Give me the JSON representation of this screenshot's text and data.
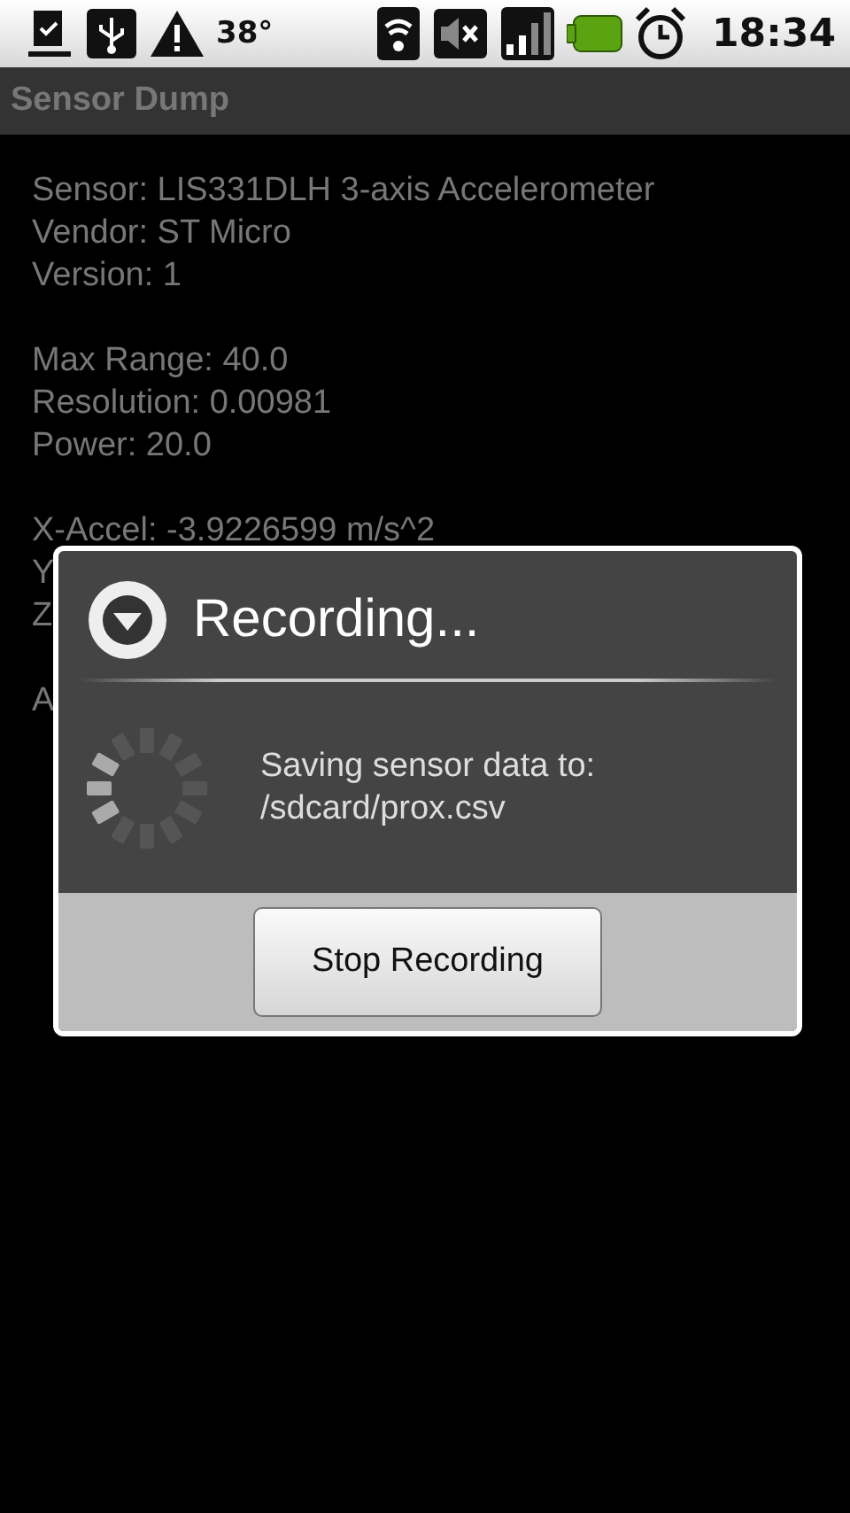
{
  "status_bar": {
    "temperature": "38°",
    "time": "18:34"
  },
  "title_bar": {
    "title": "Sensor Dump"
  },
  "sensor_info": [
    {
      "lines": [
        "Sensor: LIS331DLH 3-axis Accelerometer",
        "Vendor: ST Micro",
        "Version: 1"
      ]
    },
    {
      "lines": [
        "Max Range: 40.0",
        "Resolution: 0.00981",
        "Power: 20.0"
      ]
    },
    {
      "lines": [
        "X-Accel: -3.9226599 m/s^2",
        "Y",
        "Z"
      ]
    },
    {
      "lines": [
        "A"
      ]
    }
  ],
  "dialog": {
    "title": "Recording...",
    "message_lines": [
      "Saving sensor data to:",
      "/sdcard/prox.csv"
    ],
    "button": "Stop Recording"
  }
}
